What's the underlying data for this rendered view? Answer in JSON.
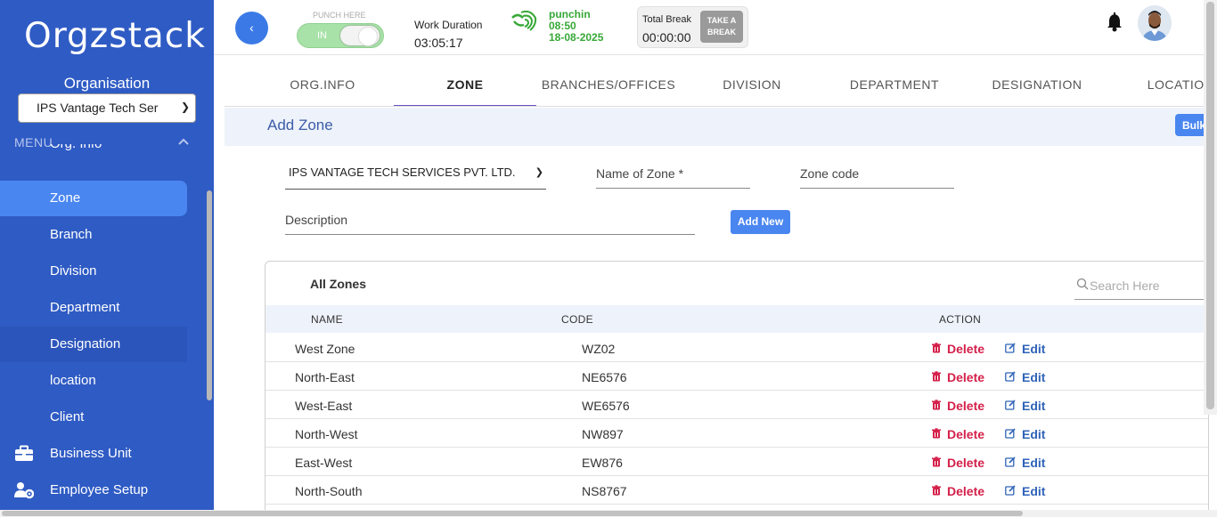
{
  "sidebar": {
    "logo": "Orgzstack",
    "org_label": "Organisation",
    "org_select_value": "IPS Vantage Tech Ser",
    "menu_header": "MENU",
    "items": [
      {
        "label": "Org. Info"
      },
      {
        "label": "Zone"
      },
      {
        "label": "Branch"
      },
      {
        "label": "Division"
      },
      {
        "label": "Department"
      },
      {
        "label": "Designation"
      },
      {
        "label": "location"
      },
      {
        "label": "Client"
      },
      {
        "label": "Business Unit",
        "icon": "briefcase-icon"
      },
      {
        "label": "Employee Setup",
        "icon": "users-gear-icon"
      }
    ]
  },
  "header": {
    "punch_label": "PUNCH HERE",
    "toggle_label": "IN",
    "work_duration_label": "Work Duration",
    "work_duration_value": "03:05:17",
    "punch_status": "punchin",
    "punch_time": "08:50",
    "punch_date": "18-08-2025",
    "break_label": "Total Break",
    "break_value": "00:00:00",
    "take_break_line1": "TAKE A",
    "take_break_line2": "BREAK"
  },
  "tabs": [
    {
      "label": "ORG.INFO"
    },
    {
      "label": "ZONE"
    },
    {
      "label": "BRANCHES/OFFICES"
    },
    {
      "label": "DIVISION"
    },
    {
      "label": "DEPARTMENT"
    },
    {
      "label": "DESIGNATION"
    },
    {
      "label": "LOCATION"
    }
  ],
  "section": {
    "title": "Add Zone",
    "bulk_button": "Bulk"
  },
  "form": {
    "company_select": "IPS VANTAGE TECH SERVICES PVT. LTD.",
    "zone_name_label": "Name of Zone  *",
    "zone_code_label": "Zone code",
    "description_label": "Description",
    "add_button": "Add New"
  },
  "table": {
    "title": "All Zones",
    "search_placeholder": "Search Here",
    "headers": {
      "name": "NAME",
      "code": "CODE",
      "action": "ACTION"
    },
    "delete_label": "Delete",
    "edit_label": "Edit",
    "rows": [
      {
        "name": "West Zone",
        "code": "WZ02"
      },
      {
        "name": "North-East",
        "code": "NE6576"
      },
      {
        "name": "West-East",
        "code": "WE6576"
      },
      {
        "name": "North-West",
        "code": "NW897"
      },
      {
        "name": "East-West",
        "code": "EW876"
      },
      {
        "name": "North-South",
        "code": "NS8767"
      }
    ]
  },
  "colors": {
    "sidebar": "#2f5bc4",
    "accent": "#4a86f0",
    "delete": "#d4204a",
    "edit": "#2f63b8",
    "punch_green": "#37a837"
  }
}
